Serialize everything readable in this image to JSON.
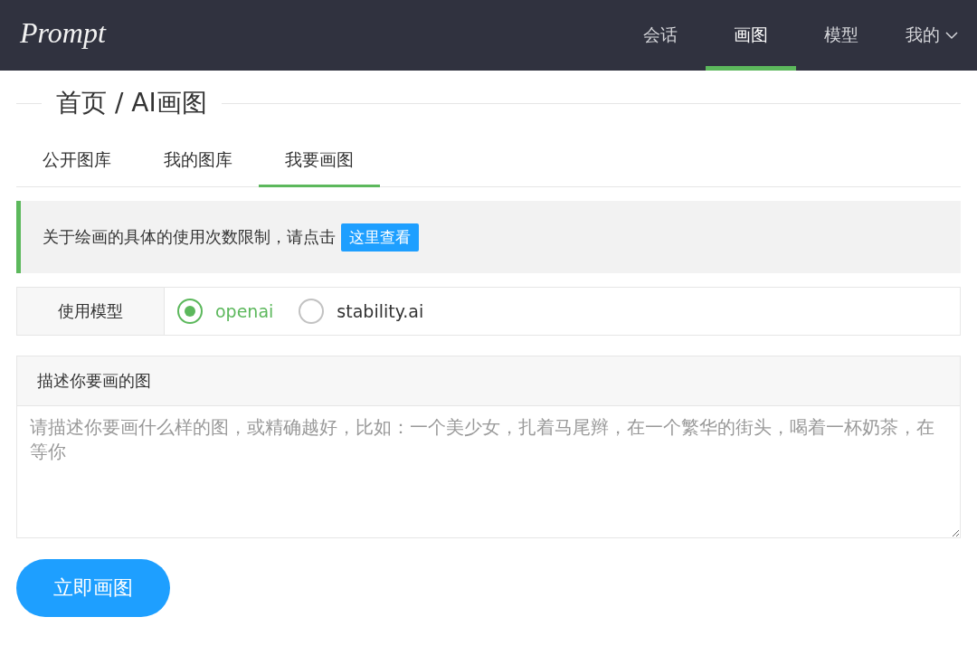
{
  "header": {
    "logo": "Prompt",
    "nav": [
      {
        "label": "会话",
        "selected": false,
        "dropdown": false
      },
      {
        "label": "画图",
        "selected": true,
        "dropdown": false
      },
      {
        "label": "模型",
        "selected": false,
        "dropdown": false
      },
      {
        "label": "我的",
        "selected": false,
        "dropdown": true
      }
    ]
  },
  "breadcrumb": "首页 / AI画图",
  "tabs": [
    {
      "label": "公开图库",
      "selected": false
    },
    {
      "label": "我的图库",
      "selected": false
    },
    {
      "label": "我要画图",
      "selected": true
    }
  ],
  "notice": {
    "text": "关于绘画的具体的使用次数限制，请点击",
    "link": "这里查看"
  },
  "model": {
    "label": "使用模型",
    "options": [
      {
        "label": "openai",
        "selected": true
      },
      {
        "label": "stability.ai",
        "selected": false
      }
    ]
  },
  "prompt": {
    "title": "描述你要画的图",
    "placeholder": "请描述你要画什么样的图，或精确越好，比如：一个美少女，扎着马尾辫，在一个繁华的街头，喝着一杯奶茶，在等你"
  },
  "submit": "立即画图"
}
